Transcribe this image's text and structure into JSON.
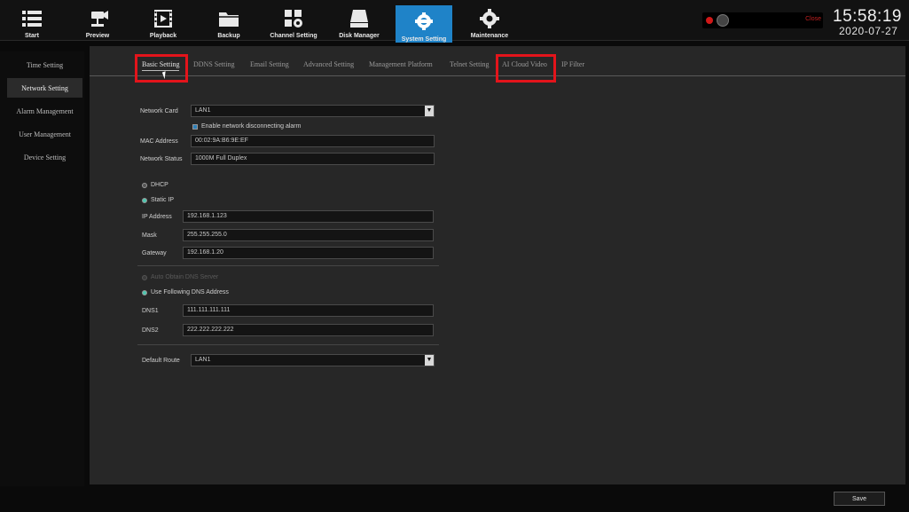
{
  "toolbar": {
    "items": [
      {
        "label": "Start",
        "icon": "grid-menu-icon"
      },
      {
        "label": "Preview",
        "icon": "camera-icon"
      },
      {
        "label": "Playback",
        "icon": "film-play-icon"
      },
      {
        "label": "Backup",
        "icon": "folder-icon"
      },
      {
        "label": "Channel Setting",
        "icon": "channel-settings-icon"
      },
      {
        "label": "Disk Manager",
        "icon": "disk-icon"
      },
      {
        "label": "System Setting",
        "icon": "system-gear-camera-icon"
      },
      {
        "label": "Maintenance",
        "icon": "gear-icon"
      }
    ],
    "active": "System Setting",
    "active_color": "#1f83c8"
  },
  "status": {
    "text": "Close"
  },
  "clock": {
    "time": "15:58:19",
    "date": "2020-07-27"
  },
  "sidebar": {
    "items": [
      "Time Setting",
      "Network Setting",
      "Alarm Management",
      "User Management",
      "Device Setting"
    ],
    "active": "Network Setting"
  },
  "tabs": {
    "items": [
      "Basic Setting",
      "DDNS Setting",
      "Email Setting",
      "Advanced Setting",
      "Management Platform",
      "Telnet Setting",
      "AI Cloud Video",
      "IP Filter"
    ],
    "active": "Basic Setting",
    "highlight_color": "#e3141b"
  },
  "form": {
    "network_card": {
      "label": "Network Card",
      "value": "LAN1"
    },
    "enable_alarm": {
      "label": "Enable network disconnecting alarm",
      "checked": true
    },
    "mac_address": {
      "label": "MAC Address",
      "value": "00:02:9A:B6:9E:EF"
    },
    "network_status": {
      "label": "Network Status",
      "value": "1000M Full Duplex"
    },
    "dhcp": {
      "label": "DHCP",
      "selected": false
    },
    "static_ip": {
      "label": "Static IP",
      "selected": true
    },
    "ip_address": {
      "label": "IP Address",
      "value": "192.168.1.123"
    },
    "mask": {
      "label": "Mask",
      "value": "255.255.255.0"
    },
    "gateway": {
      "label": "Gateway",
      "value": "192.168.1.20"
    },
    "auto_dns": {
      "label": "Auto Obtain DNS Server",
      "selected": false
    },
    "following_dns": {
      "label": "Use Following DNS Address",
      "selected": true
    },
    "dns1": {
      "label": "DNS1",
      "value": "111.111.111.111"
    },
    "dns2": {
      "label": "DNS2",
      "value": "222.222.222.222"
    },
    "default_route": {
      "label": "Default Route",
      "value": "LAN1"
    }
  },
  "save_label": "Save"
}
